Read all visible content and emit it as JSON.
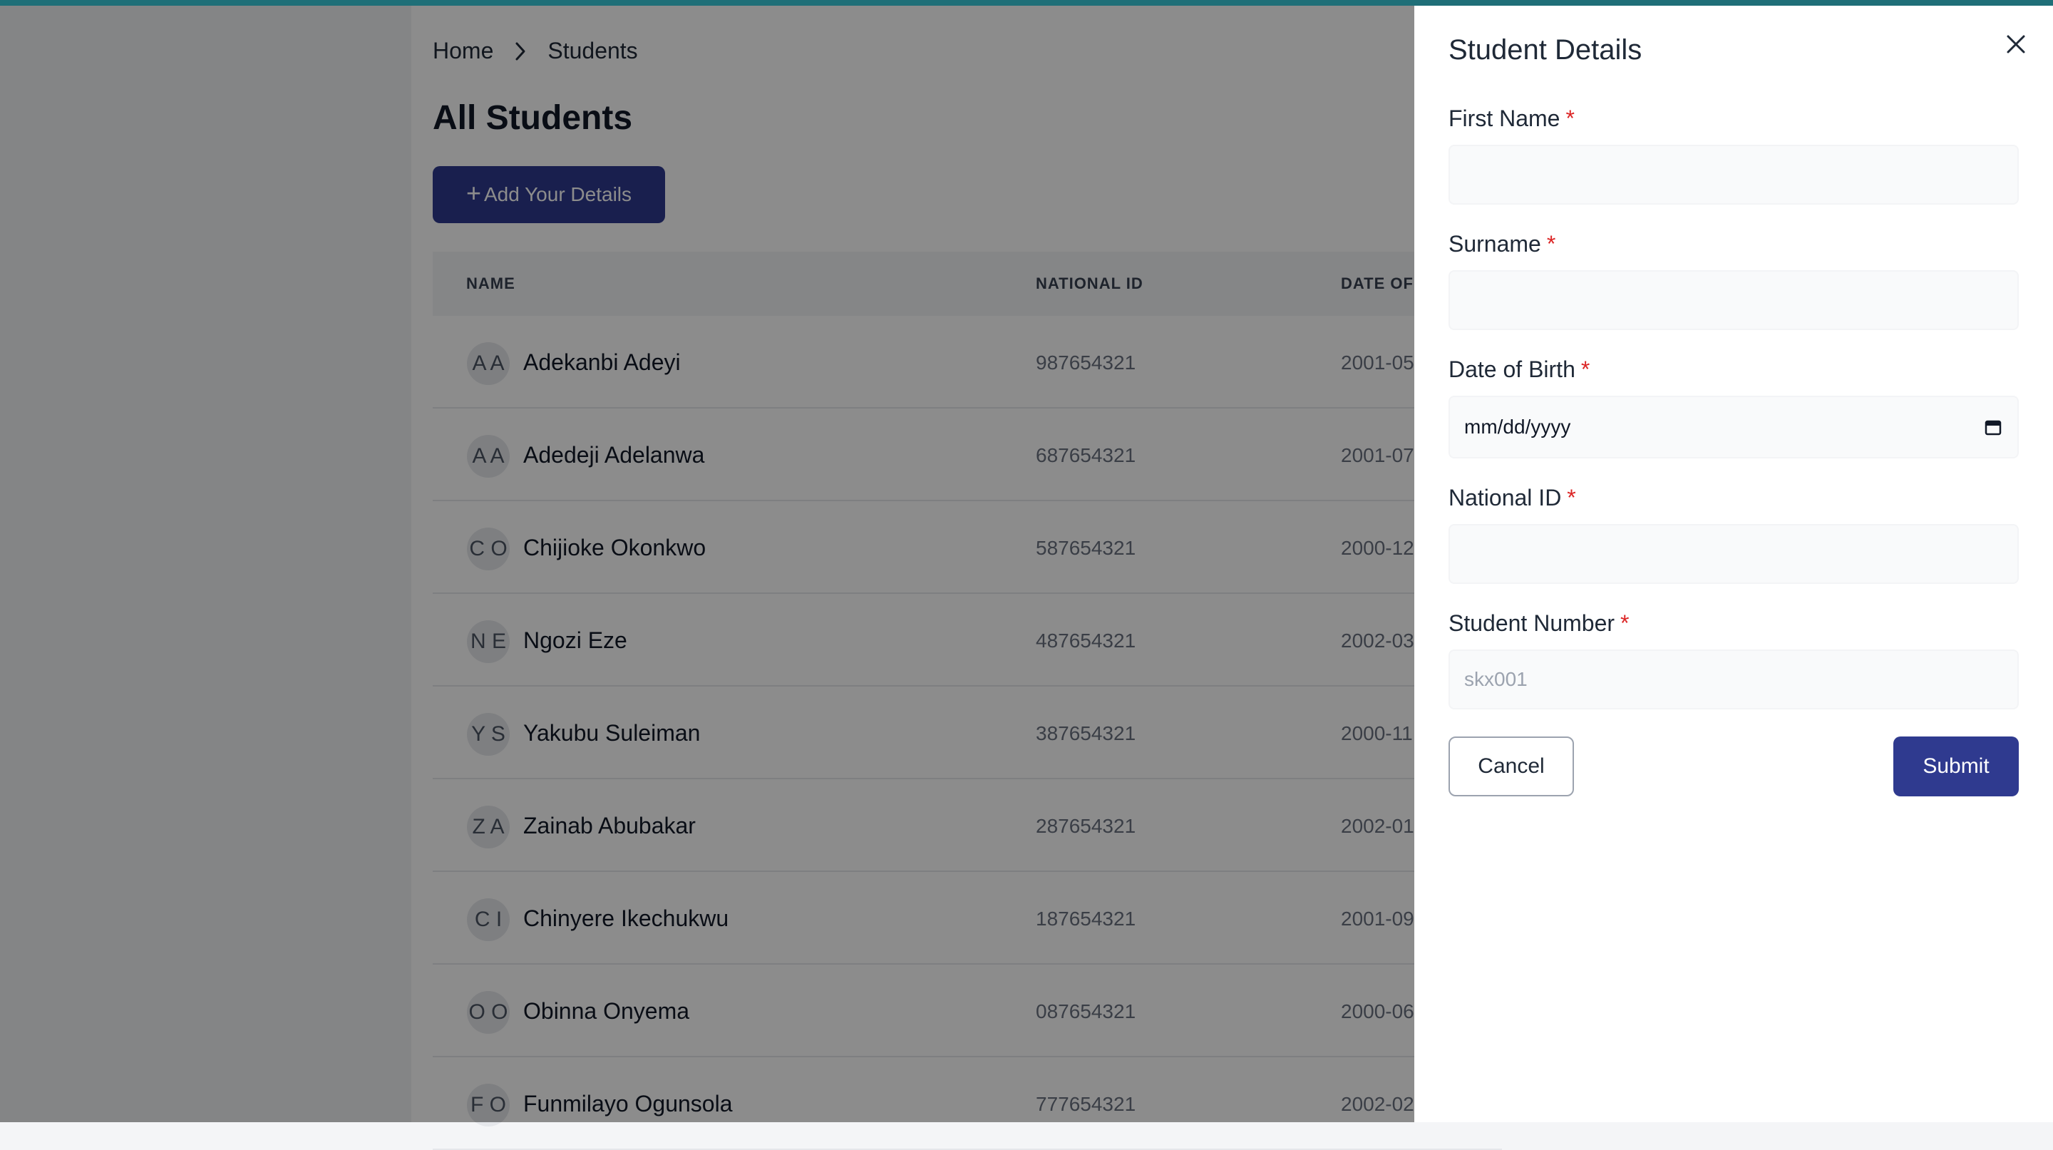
{
  "breadcrumb": {
    "home": "Home",
    "current": "Students"
  },
  "page": {
    "title": "All Students",
    "add_button": "Add Your Details"
  },
  "table": {
    "headers": {
      "name": "NAME",
      "national_id": "NATIONAL ID",
      "dob": "DATE OF"
    },
    "rows": [
      {
        "initials": "A A",
        "name": "Adekanbi Adeyi",
        "national_id": "987654321",
        "dob": "2001-05"
      },
      {
        "initials": "A A",
        "name": "Adedeji Adelanwa",
        "national_id": "687654321",
        "dob": "2001-07"
      },
      {
        "initials": "C O",
        "name": "Chijioke Okonkwo",
        "national_id": "587654321",
        "dob": "2000-12"
      },
      {
        "initials": "N E",
        "name": "Ngozi Eze",
        "national_id": "487654321",
        "dob": "2002-03"
      },
      {
        "initials": "Y S",
        "name": "Yakubu Suleiman",
        "national_id": "387654321",
        "dob": "2000-11"
      },
      {
        "initials": "Z A",
        "name": "Zainab Abubakar",
        "national_id": "287654321",
        "dob": "2002-01"
      },
      {
        "initials": "C I",
        "name": "Chinyere Ikechukwu",
        "national_id": "187654321",
        "dob": "2001-09"
      },
      {
        "initials": "O O",
        "name": "Obinna Onyema",
        "national_id": "087654321",
        "dob": "2000-06"
      },
      {
        "initials": "F O",
        "name": "Funmilayo Ogunsola",
        "national_id": "777654321",
        "dob": "2002-02"
      }
    ]
  },
  "drawer": {
    "title": "Student Details",
    "fields": {
      "first_name": {
        "label": "First Name",
        "value": "",
        "placeholder": ""
      },
      "surname": {
        "label": "Surname",
        "value": "",
        "placeholder": ""
      },
      "dob": {
        "label": "Date of Birth",
        "value": "mm/dd/yyyy"
      },
      "national_id": {
        "label": "National ID",
        "value": "",
        "placeholder": ""
      },
      "student_number": {
        "label": "Student Number",
        "value": "",
        "placeholder": "skx001"
      }
    },
    "required_marker": "*",
    "cancel_label": "Cancel",
    "submit_label": "Submit"
  },
  "icons": {
    "breadcrumb_separator": "chevron-right-icon",
    "add": "plus-icon",
    "close": "close-icon",
    "calendar": "calendar-icon"
  },
  "colors": {
    "accent": "#2f3a8f",
    "topbar": "#1f6f78",
    "required": "#dc2626"
  }
}
